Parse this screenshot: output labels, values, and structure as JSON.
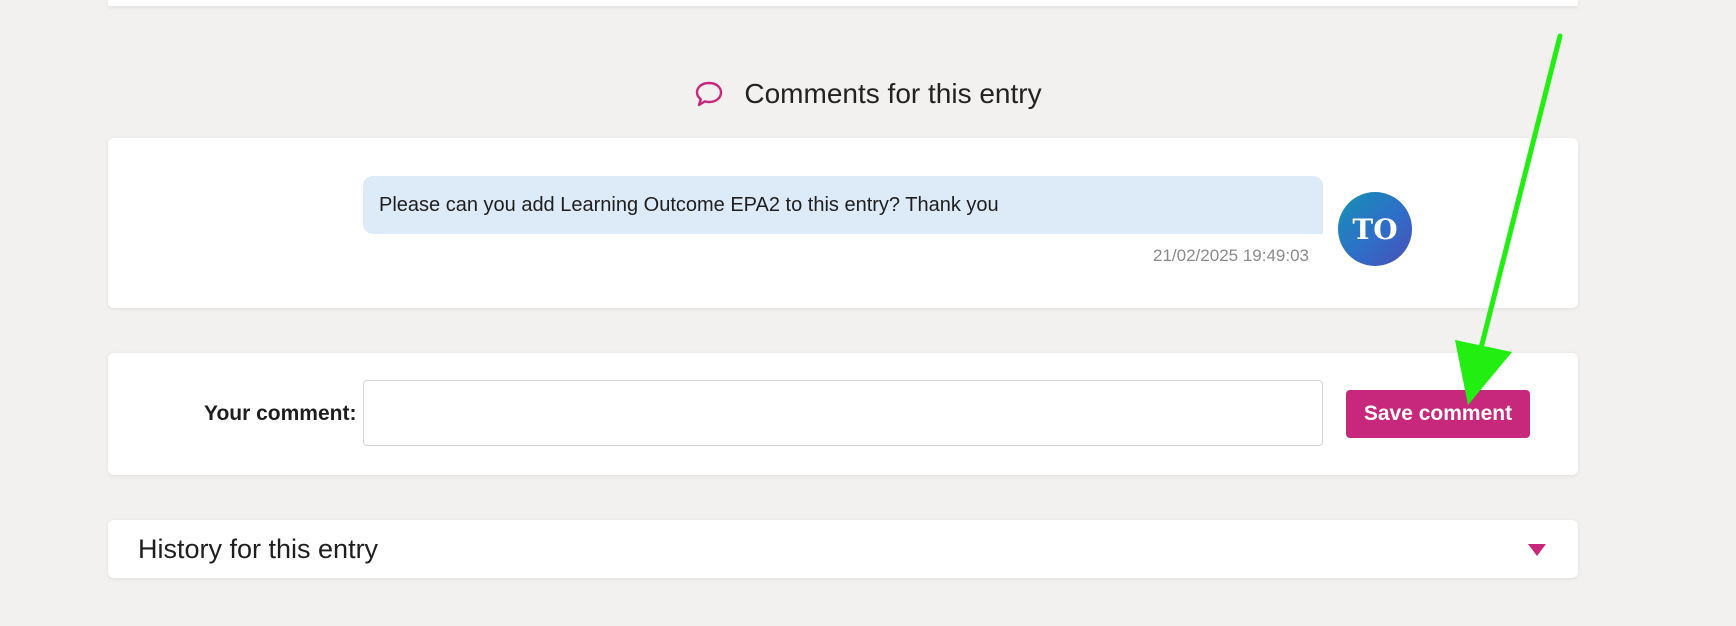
{
  "header": {
    "icon": "comment-icon",
    "title": "Comments for this entry"
  },
  "comments": [
    {
      "text": "Please can you add Learning Outcome EPA2 to this entry? Thank you",
      "timestamp": "21/02/2025 19:49:03",
      "avatar_initials": "TO"
    }
  ],
  "comment_form": {
    "label": "Your comment:",
    "input_value": "",
    "save_label": "Save comment"
  },
  "history": {
    "title": "History for this entry",
    "toggle_icon": "caret-down-icon"
  },
  "colors": {
    "accent": "#c8287c",
    "bubble": "#ddeaf7",
    "annotation_arrow": "#22ee11"
  }
}
